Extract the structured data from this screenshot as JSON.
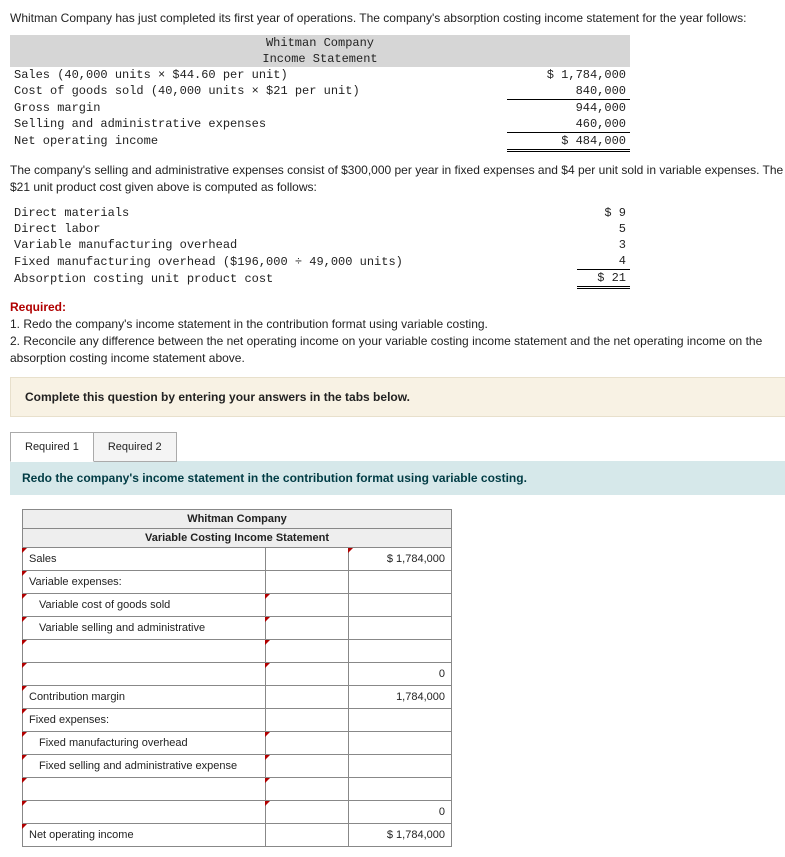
{
  "intro": "Whitman Company has just completed its first year of operations. The company's absorption costing income statement for the year follows:",
  "income_header1": "Whitman Company",
  "income_header2": "Income Statement",
  "income_rows": [
    {
      "label": "Sales (40,000 units × $44.60 per unit)",
      "amount": "$ 1,784,000"
    },
    {
      "label": "Cost of goods sold (40,000 units × $21 per unit)",
      "amount": "840,000"
    },
    {
      "label": "Gross margin",
      "amount": "944,000"
    },
    {
      "label": "Selling and administrative expenses",
      "amount": "460,000"
    },
    {
      "label": "Net operating income",
      "amount": "$ 484,000"
    }
  ],
  "para2": "The company's selling and administrative expenses consist of $300,000 per year in fixed expenses and $4 per unit sold in variable expenses. The $21 unit product cost given above is computed as follows:",
  "cost_rows": [
    {
      "label": "Direct materials",
      "amount": "$ 9"
    },
    {
      "label": "Direct labor",
      "amount": "5"
    },
    {
      "label": "Variable manufacturing overhead",
      "amount": "3"
    },
    {
      "label": "Fixed manufacturing overhead ($196,000 ÷ 49,000 units)",
      "amount": "4"
    },
    {
      "label": "Absorption costing unit product cost",
      "amount": "$ 21"
    }
  ],
  "required_hdr": "Required:",
  "required1": "1. Redo the company's income statement in the contribution format using variable costing.",
  "required2": "2. Reconcile any difference between the net operating income on your variable costing income statement and the net operating income on the absorption costing income statement above.",
  "instruction": "Complete this question by entering your answers in the tabs below.",
  "tabs": {
    "r1": "Required 1",
    "r2": "Required 2"
  },
  "tab_prompt": "Redo the company's income statement in the contribution format using variable costing.",
  "ans_header1": "Whitman Company",
  "ans_header2": "Variable Costing Income Statement",
  "ans_rows": {
    "sales": "Sales",
    "sales_val": "$ 1,784,000",
    "var_exp": "Variable expenses:",
    "vcogs": "Variable cost of goods sold",
    "vsga": "Variable selling and administrative",
    "subtotal1": "0",
    "cm": "Contribution margin",
    "cm_val": "1,784,000",
    "fixed_exp": "Fixed expenses:",
    "fmoh": "Fixed manufacturing overhead",
    "fsga": "Fixed selling and administrative expense",
    "subtotal2": "0",
    "noi": "Net operating income",
    "noi_val": "$ 1,784,000"
  }
}
